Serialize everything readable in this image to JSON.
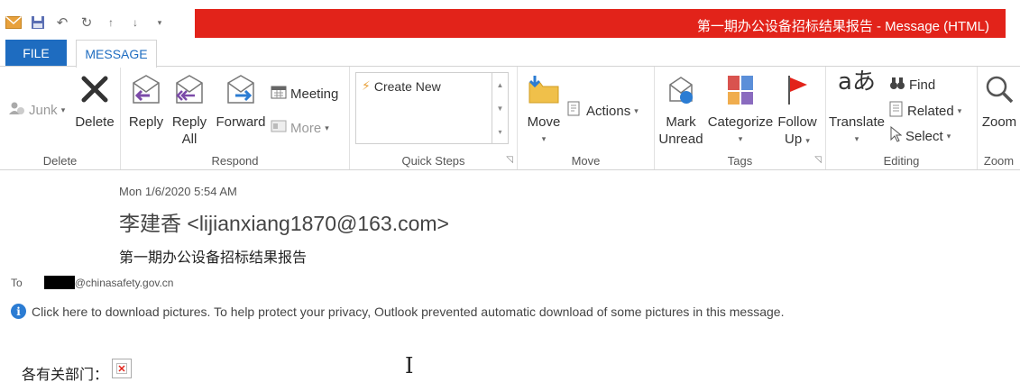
{
  "window": {
    "title": "第一期办公设备招标结果报告 - Message (HTML)"
  },
  "tabs": [
    {
      "label": "FILE"
    },
    {
      "label": "MESSAGE"
    }
  ],
  "ribbon": {
    "delete_group": {
      "label": "Delete",
      "junk": "Junk",
      "delete": "Delete"
    },
    "respond_group": {
      "label": "Respond",
      "reply": "Reply",
      "reply_all_1": "Reply",
      "reply_all_2": "All",
      "forward": "Forward",
      "meeting": "Meeting",
      "more": "More"
    },
    "quick_steps_group": {
      "label": "Quick Steps",
      "create_new": "Create New"
    },
    "move_group": {
      "label": "Move",
      "move": "Move",
      "actions": "Actions"
    },
    "tags_group": {
      "label": "Tags",
      "mark_unread_1": "Mark",
      "mark_unread_2": "Unread",
      "categorize": "Categorize",
      "follow_up_1": "Follow",
      "follow_up_2": "Up"
    },
    "editing_group": {
      "label": "Editing",
      "translate": "Translate",
      "find": "Find",
      "related": "Related",
      "select": "Select"
    },
    "zoom_group": {
      "label": "Zoom",
      "zoom": "Zoom"
    }
  },
  "message": {
    "date": "Mon 1/6/2020 5:54 AM",
    "sender": "李建香 <lijianxiang1870@163.com>",
    "subject": "第一期办公设备招标结果报告",
    "to_label": "To",
    "to_domain": "@chinasafety.gov.cn",
    "info_bar": "Click here to download pictures. To help protect your privacy, Outlook prevented automatic download of some pictures in this message.",
    "body_greeting": "各有关部门："
  },
  "colors": {
    "title_bar": "#e2231a",
    "file_tab": "#1e6cc0",
    "accent": "#1e6cc0",
    "info_icon": "#2b7cd3"
  }
}
